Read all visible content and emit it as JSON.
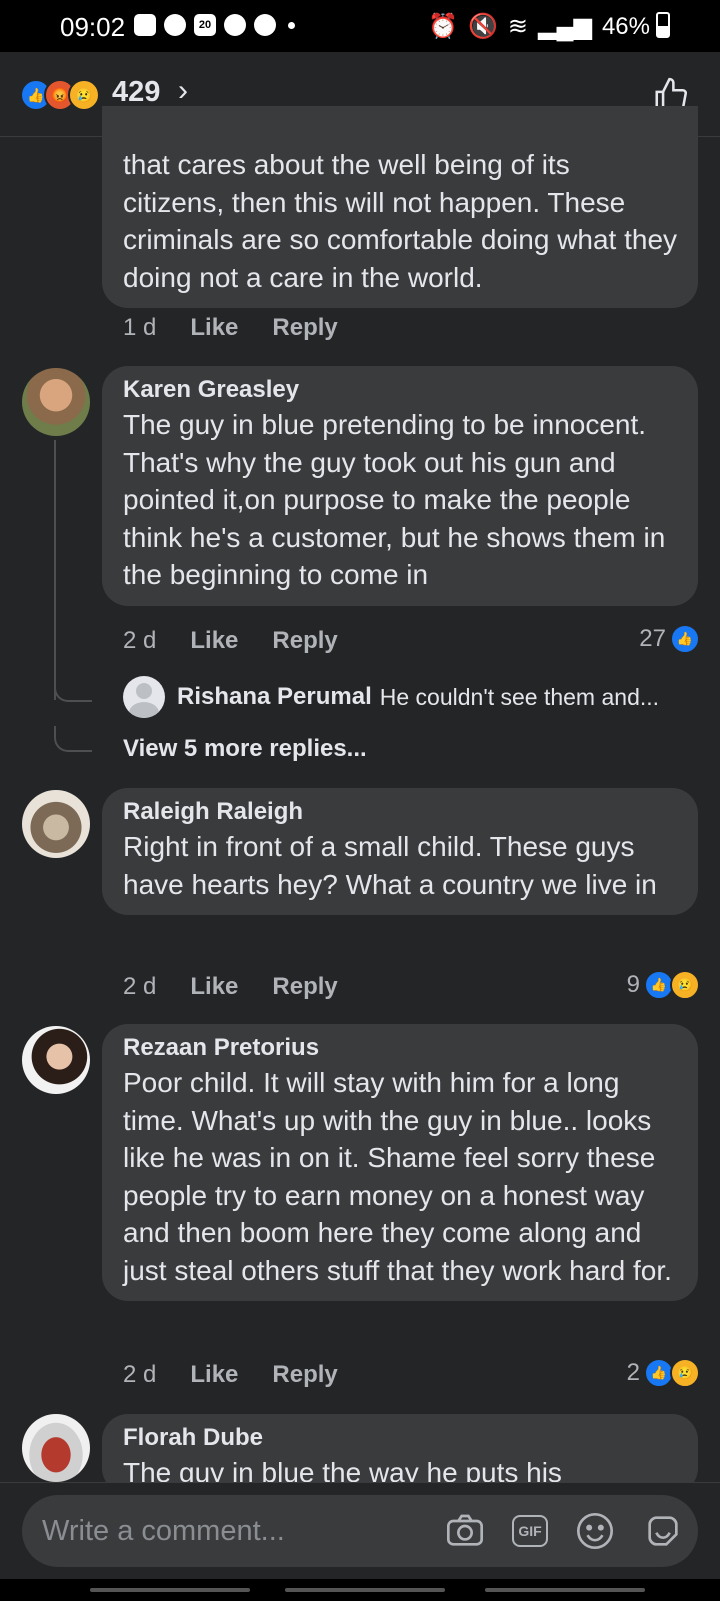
{
  "status": {
    "time": "09:02",
    "battery": "46%",
    "notif_badge": "20"
  },
  "header": {
    "reaction_count": "429"
  },
  "partial_comment": {
    "text": "that cares about the well being of its citizens, then this will not happen. These criminals are so comfortable doing what they doing not a care in the world.",
    "time": "1 d",
    "like": "Like",
    "reply": "Reply"
  },
  "comments": [
    {
      "name": "Karen Greasley",
      "text": "The guy in blue pretending to be innocent. That's why the guy took out his gun and pointed it,on purpose to make the people think he's a customer, but he shows them in the beginning to come in",
      "time": "2 d",
      "like": "Like",
      "reply": "Reply",
      "reactions": "27",
      "reply_preview": {
        "name": "Rishana Perumal",
        "text": "He couldn't see them and..."
      },
      "view_more": "View 5 more replies..."
    },
    {
      "name": "Raleigh Raleigh",
      "text": "Right in front of a small child. These guys have hearts hey? What a country we live in",
      "time": "2 d",
      "like": "Like",
      "reply": "Reply",
      "reactions": "9"
    },
    {
      "name": "Rezaan Pretorius",
      "text": "Poor child. It will stay with him for a long time. What's up with the guy in blue.. looks like he was in on it. Shame feel sorry these people try to earn money on a honest way and then boom here they come along and just steal others stuff that they work hard for.",
      "time": "2 d",
      "like": "Like",
      "reply": "Reply",
      "reactions": "2"
    },
    {
      "name": "Florah Dube",
      "text": "The guy in blue the way he puts his"
    }
  ],
  "composer": {
    "placeholder": "Write a comment...",
    "gif_label": "GIF"
  },
  "colors": {
    "like": "#1877f2",
    "bubble": "#3a3b3c",
    "background": "#242526"
  }
}
